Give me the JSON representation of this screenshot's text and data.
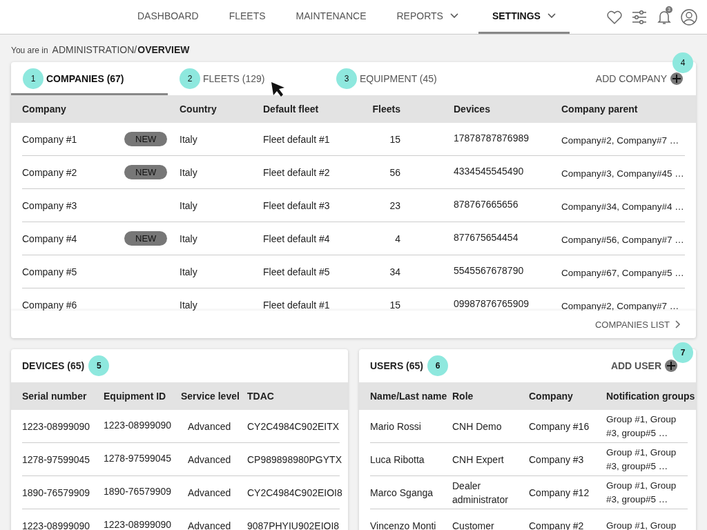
{
  "nav": {
    "items": [
      {
        "label": "DASHBOARD",
        "selected": false,
        "has_menu": false
      },
      {
        "label": "FLEETS",
        "selected": false,
        "has_menu": false
      },
      {
        "label": "MAINTENANCE",
        "selected": false,
        "has_menu": false
      },
      {
        "label": "REPORTS",
        "selected": false,
        "has_menu": true
      },
      {
        "label": "SETTINGS",
        "selected": true,
        "has_menu": true
      }
    ],
    "notification_count": "3"
  },
  "breadcrumb": {
    "prefix": "You are in",
    "path": "ADMINISTRATION/",
    "current": "OVERVIEW"
  },
  "companies_panel": {
    "tabs": [
      {
        "label": "COMPANIES (67)",
        "marker": "1",
        "selected": true
      },
      {
        "label": "FLEETS (129)",
        "marker": "2",
        "selected": false
      },
      {
        "label": "EQUIPMENT (45)",
        "marker": "3",
        "selected": false
      }
    ],
    "add_button": {
      "label": "ADD COMPANY",
      "marker": "4"
    },
    "columns": [
      "Company",
      "Country",
      "Default fleet",
      "Fleets",
      "Devices",
      "Company parent"
    ],
    "rows": [
      {
        "company": "Company #1",
        "new": true,
        "badge": "NEW",
        "country": "Italy",
        "default_fleet": "Fleet default #1",
        "fleets": "15",
        "devices": "17878787876989",
        "parent": "Company#2, Company#7   …"
      },
      {
        "company": "Company #2",
        "new": true,
        "badge": "NEW",
        "country": "Italy",
        "default_fleet": "Fleet default #2",
        "fleets": "56",
        "devices": "4334545545490",
        "parent": "Company#3, Company#45 …"
      },
      {
        "company": "Company #3",
        "new": false,
        "country": "Italy",
        "default_fleet": "Fleet default #3",
        "fleets": "23",
        "devices": "878767665656",
        "parent": "Company#34, Company#4 …"
      },
      {
        "company": "Company #4",
        "new": true,
        "badge": "NEW",
        "country": "Italy",
        "default_fleet": "Fleet default #4",
        "fleets": "4",
        "devices": "877675654454",
        "parent": "Company#56, Company#7 …"
      },
      {
        "company": "Company #5",
        "new": false,
        "country": "Italy",
        "default_fleet": "Fleet default #5",
        "fleets": "34",
        "devices": "5545567678790",
        "parent": "Company#67, Company#5 …"
      },
      {
        "company": "Company #6",
        "new": false,
        "country": "Italy",
        "default_fleet": "Fleet default #1",
        "fleets": "15",
        "devices": "09987876765909",
        "parent": "Company#2, Company#7 …"
      }
    ],
    "footer_link": "COMPANIES LIST"
  },
  "devices_panel": {
    "title": "DEVICES (65)",
    "marker": "5",
    "columns": [
      "Serial number",
      "Equipment ID",
      "Service level",
      "TDAC"
    ],
    "rows": [
      [
        "1223-08999090",
        "1223-08999090",
        "Advanced",
        "CY2C4984C902EITX"
      ],
      [
        "1278-97599045",
        "1278-97599045",
        "Advanced",
        "CP989898980PGYTX"
      ],
      [
        "1890-76579909",
        "1890-76579909",
        "Advanced",
        "CY2C4984C902EIOI8"
      ],
      [
        "1223-08999090",
        "1223-08999090",
        "Advanced",
        "9087PHYIU902EIOI8"
      ]
    ]
  },
  "users_panel": {
    "title": "USERS (65)",
    "marker": "6",
    "add_button": {
      "label": "ADD USER",
      "marker": "7"
    },
    "columns": [
      "Name/Last name",
      "Role",
      "Company",
      "Notification groups"
    ],
    "rows": [
      [
        "Mario Rossi",
        "CNH Demo",
        "Company #16",
        "Group #1, Group #3, group#5 …"
      ],
      [
        "Luca Ribotta",
        "CNH Expert",
        "Company #3",
        "Group #1, Group #3, group#5 …"
      ],
      [
        "Marco Sganga",
        "Dealer administrator",
        "Company #12",
        "Group #1, Group #3, group#5 …"
      ],
      [
        "Vincenzo Monti",
        "Customer",
        "Company #2",
        "Group #1, Group"
      ]
    ]
  }
}
